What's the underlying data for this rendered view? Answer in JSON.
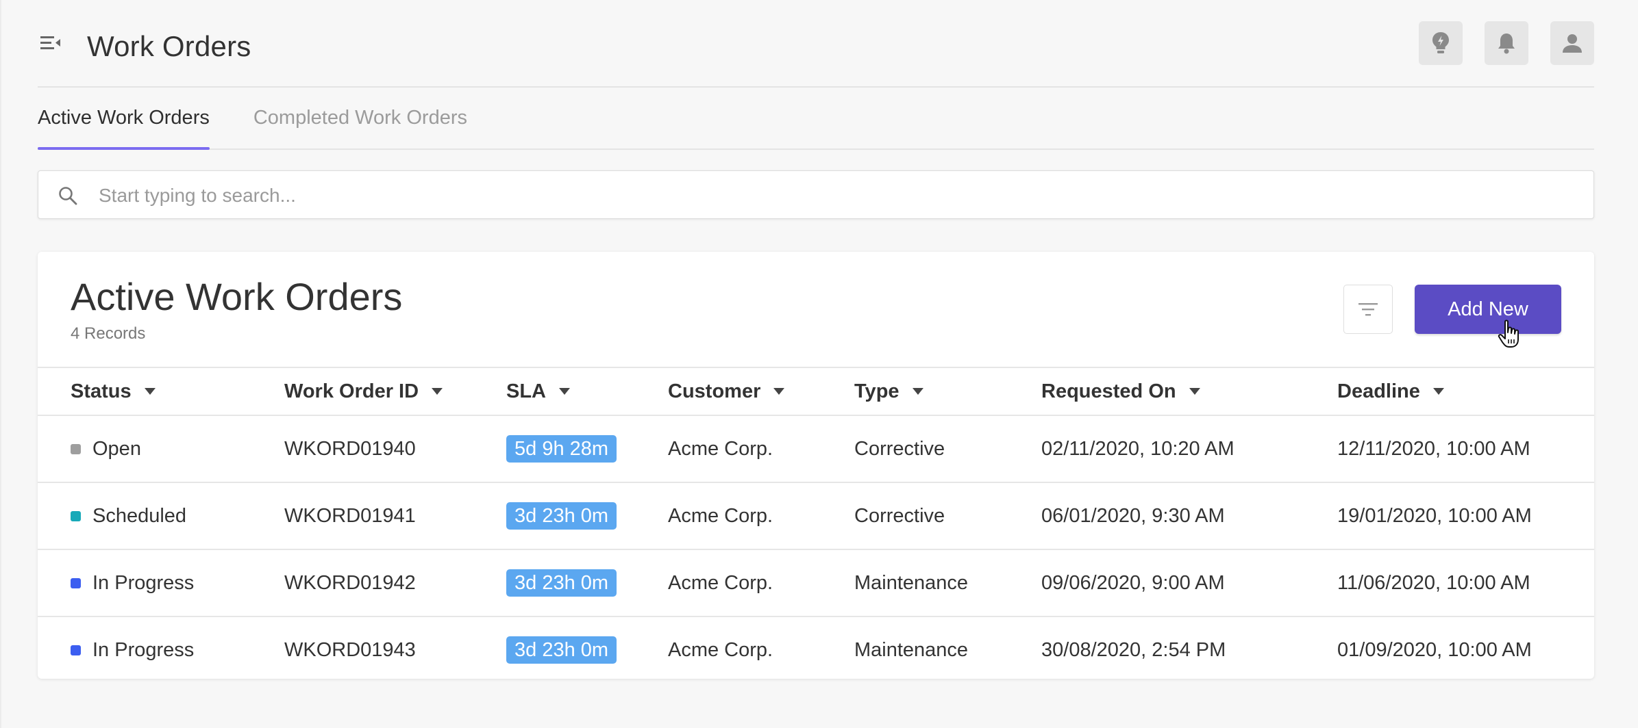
{
  "header": {
    "title": "Work Orders",
    "icons": [
      "menu-collapse-icon",
      "lightbulb-icon",
      "bell-icon",
      "user-icon"
    ]
  },
  "tabs": [
    {
      "label": "Active Work Orders",
      "active": true
    },
    {
      "label": "Completed Work Orders",
      "active": false
    }
  ],
  "search": {
    "placeholder": "Start typing to search...",
    "value": ""
  },
  "card": {
    "title": "Active Work Orders",
    "records": "4 Records",
    "add_label": "Add New"
  },
  "columns": [
    "Status",
    "Work Order ID",
    "SLA",
    "Customer",
    "Type",
    "Requested On",
    "Deadline"
  ],
  "rows": [
    {
      "status": "Open",
      "status_color": "#9e9e9e",
      "id": "WKORD01940",
      "sla": "5d 9h 28m",
      "customer": "Acme Corp.",
      "type": "Corrective",
      "requested": "02/11/2020, 10:20 AM",
      "deadline": "12/11/2020, 10:00 AM"
    },
    {
      "status": "Scheduled",
      "status_color": "#17a9b8",
      "id": "WKORD01941",
      "sla": "3d 23h 0m",
      "customer": "Acme Corp.",
      "type": "Corrective",
      "requested": "06/01/2020, 9:30 AM",
      "deadline": "19/01/2020, 10:00 AM"
    },
    {
      "status": "In Progress",
      "status_color": "#3c5ef0",
      "id": "WKORD01942",
      "sla": "3d 23h 0m",
      "customer": "Acme Corp.",
      "type": "Maintenance",
      "requested": "09/06/2020, 9:00 AM",
      "deadline": "11/06/2020, 10:00 AM"
    },
    {
      "status": "In Progress",
      "status_color": "#3c5ef0",
      "id": "WKORD01943",
      "sla": "3d 23h 0m",
      "customer": "Acme Corp.",
      "type": "Maintenance",
      "requested": "30/08/2020, 2:54 PM",
      "deadline": "01/09/2020, 10:00 AM"
    }
  ],
  "colors": {
    "accent": "#5b4cc4",
    "tab_underline": "#7b6cf0",
    "sla_badge": "#5ba7f0"
  }
}
